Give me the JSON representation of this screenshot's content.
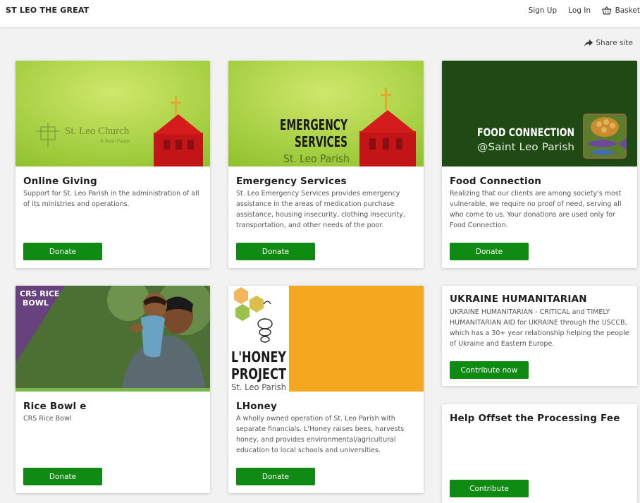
{
  "header": {
    "site_name": "ST LEO THE GREAT",
    "sign_up": "Sign Up",
    "log_in": "Log In",
    "basket": "Basket",
    "basket_icon": "basket-icon"
  },
  "share": {
    "label": "Share site",
    "icon": "share-arrow-icon"
  },
  "colors": {
    "button_green": "#0f8a12",
    "card_bg": "#ffffff",
    "page_bg": "#f2f2f2"
  },
  "cards": [
    {
      "title": "Online Giving",
      "description": "Support for St. Leo Parish in the administration of all of its ministries and operations.",
      "button": "Donate",
      "image_text": {
        "line1": "St. Leo Church",
        "line2": "A Jesuit Parish"
      }
    },
    {
      "title": "Emergency Services",
      "description": "St. Leo Emergency Services provides emergency assistance in the areas of medication purchase assistance, housing insecurity, clothing insecurity, transportation, and other needs of the poor.",
      "button": "Donate",
      "image_text": {
        "line1": "EMERGENCY",
        "line2": "SERVICES",
        "line3": "St. Leo Parish"
      }
    },
    {
      "title": "Food Connection",
      "description": "Realizing that our clients are among society's most vulnerable, we require no proof of need, serving all who come to us. Your donations are used only for Food Connection.",
      "button": "Donate",
      "image_text": {
        "line1": "FOOD CONNECTION",
        "line2": "@Saint Leo Parish"
      }
    },
    {
      "title": "Rice Bowl e",
      "description": "CRS Rice Bowl",
      "button": "Donate",
      "image_text": {
        "line1": "CRS RICE",
        "line2": "BOWL"
      }
    },
    {
      "title": "LHoney",
      "description": "A wholly owned operation of St. Leo Parish with separate financials. L'Honey raises bees, harvests honey, and provides environmental/agricultural education to local schools and universities.",
      "button": "Donate",
      "image_text": {
        "line1": "L'HONEY",
        "line2": "PROJECT",
        "line3": "St. Leo Parish"
      }
    },
    {
      "title": "UKRAINE HUMANITARIAN",
      "description": "UKRAINE HUMANITARIAN - CRITICAL and TIMELY HUMANITARIAN AID for UKRAINE through the USCCB, which has a 30+ year relationship helping the people of Ukraine and Eastern Europe.",
      "button": "Contribute now"
    },
    {
      "title": "Help Offset the Processing Fee",
      "button": "Contribute"
    }
  ]
}
